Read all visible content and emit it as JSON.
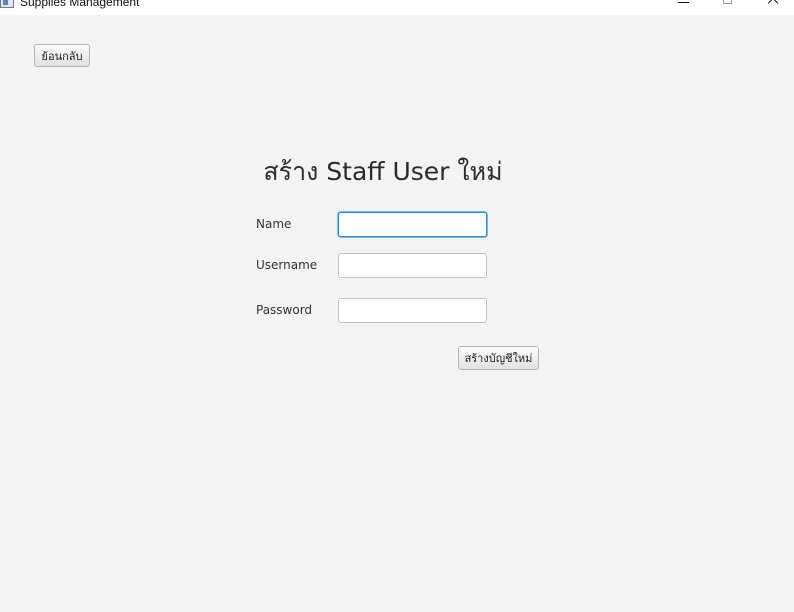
{
  "window": {
    "title": "Supplies Management",
    "controls": [
      "minimize-icon",
      "maximize-icon",
      "close-icon"
    ]
  },
  "toolbar": {
    "back_label": "ย้อนกลับ"
  },
  "form": {
    "title": "สร้าง Staff User ใหม่",
    "fields": [
      {
        "label": "Name",
        "value": "",
        "placeholder": "",
        "focused": true
      },
      {
        "label": "Username",
        "value": "",
        "placeholder": ""
      },
      {
        "label": "Password",
        "value": "",
        "placeholder": ""
      }
    ],
    "submit_label": "สร้างบัญชีใหม่"
  },
  "colors": {
    "background": "#f4f4f4",
    "focus_border": "#2a8ad4"
  }
}
